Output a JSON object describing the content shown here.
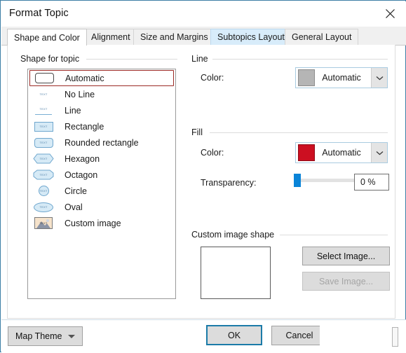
{
  "window": {
    "title": "Format Topic",
    "close_icon": "close-icon"
  },
  "tabs": [
    {
      "label": "Shape and Color",
      "state": "selected"
    },
    {
      "label": "Alignment",
      "state": "normal"
    },
    {
      "label": "Size and Margins",
      "state": "normal"
    },
    {
      "label": "Subtopics Layout",
      "state": "hover"
    },
    {
      "label": "General Layout",
      "state": "normal"
    }
  ],
  "shape_group": {
    "label": "Shape for topic",
    "items": [
      {
        "label": "Automatic",
        "icon": "rounded-rectangle-outline-icon",
        "selected": true
      },
      {
        "label": "No Line",
        "icon": "no-line-icon",
        "selected": false
      },
      {
        "label": "Line",
        "icon": "underline-icon",
        "selected": false
      },
      {
        "label": "Rectangle",
        "icon": "rectangle-icon",
        "selected": false
      },
      {
        "label": "Rounded rectangle",
        "icon": "rounded-rectangle-icon",
        "selected": false
      },
      {
        "label": "Hexagon",
        "icon": "hexagon-icon",
        "selected": false
      },
      {
        "label": "Octagon",
        "icon": "octagon-icon",
        "selected": false
      },
      {
        "label": "Circle",
        "icon": "circle-icon",
        "selected": false
      },
      {
        "label": "Oval",
        "icon": "oval-icon",
        "selected": false
      },
      {
        "label": "Custom image",
        "icon": "picture-icon",
        "selected": false
      }
    ],
    "icon_micro_text": "TEXT"
  },
  "line_group": {
    "label": "Line",
    "color_label": "Color:",
    "color_value": "Automatic",
    "color_swatch": "#b5b5b5",
    "dropdown_icon": "chevron-down-icon"
  },
  "fill_group": {
    "label": "Fill",
    "color_label": "Color:",
    "color_value": "Automatic",
    "color_swatch": "#cc0f21",
    "dropdown_icon": "chevron-down-icon",
    "transparency_label": "Transparency:",
    "transparency_value": "0 %",
    "transparency_percent": 0
  },
  "custom_image_group": {
    "label": "Custom image shape",
    "select_image_label": "Select Image...",
    "save_image_label": "Save Image...",
    "save_image_disabled": true
  },
  "footer": {
    "map_theme_label": "Map Theme",
    "map_theme_icon": "caret-down-icon",
    "ok_label": "OK",
    "cancel_label": "Cancel"
  },
  "colors": {
    "accent": "#1b7ba8",
    "selection_border": "#9c2a26",
    "tab_hover": "#d8ecfa",
    "slider_thumb": "#0a84d8"
  }
}
